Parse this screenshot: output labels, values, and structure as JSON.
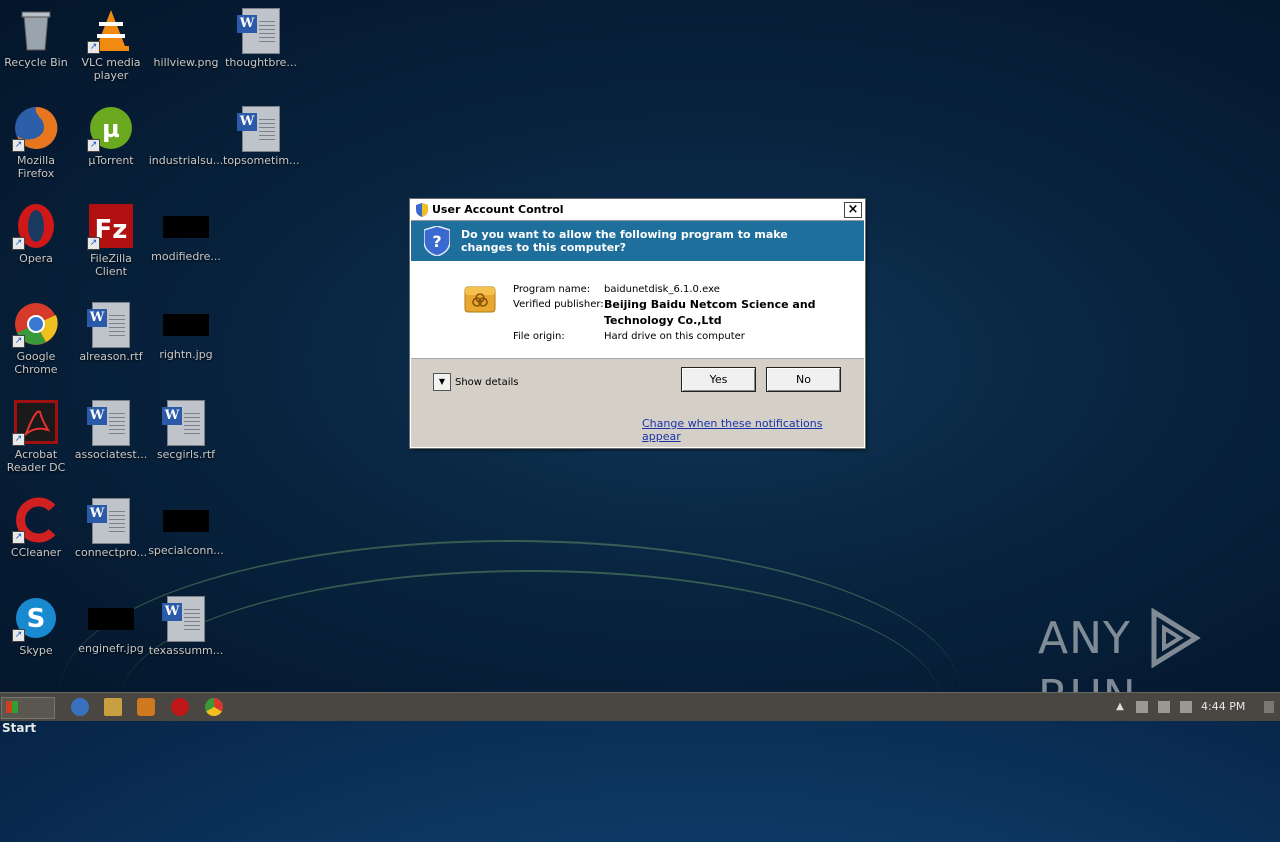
{
  "desktop": {
    "icons": [
      {
        "label": "Recycle Bin",
        "icon": "recycle-bin-icon"
      },
      {
        "label": "VLC media player",
        "icon": "vlc-icon"
      },
      {
        "label": "hillview.png",
        "icon": "image-file-icon"
      },
      {
        "label": "thoughtbre...",
        "icon": "word-doc-icon"
      },
      {
        "label": "Mozilla Firefox",
        "icon": "firefox-icon"
      },
      {
        "label": "µTorrent",
        "icon": "utorrent-icon"
      },
      {
        "label": "industrialsu...",
        "icon": "image-file-icon"
      },
      {
        "label": "topsometim...",
        "icon": "word-doc-icon"
      },
      {
        "label": "Opera",
        "icon": "opera-icon"
      },
      {
        "label": "FileZilla Client",
        "icon": "filezilla-icon"
      },
      {
        "label": "modifiedre...",
        "icon": "image-file-icon"
      },
      {
        "label": "Google Chrome",
        "icon": "chrome-icon"
      },
      {
        "label": "alreason.rtf",
        "icon": "word-doc-icon"
      },
      {
        "label": "rightn.jpg",
        "icon": "image-file-icon"
      },
      {
        "label": "Acrobat Reader DC",
        "icon": "acrobat-icon"
      },
      {
        "label": "associatest...",
        "icon": "word-doc-icon"
      },
      {
        "label": "secgirls.rtf",
        "icon": "word-doc-icon"
      },
      {
        "label": "CCleaner",
        "icon": "ccleaner-icon"
      },
      {
        "label": "connectpro...",
        "icon": "word-doc-icon"
      },
      {
        "label": "specialconn...",
        "icon": "image-file-icon"
      },
      {
        "label": "Skype",
        "icon": "skype-icon"
      },
      {
        "label": "enginefr.jpg",
        "icon": "image-file-icon"
      },
      {
        "label": "texassumm...",
        "icon": "word-doc-icon"
      }
    ]
  },
  "uac": {
    "title": "User Account Control",
    "question": "Do you want to allow the following program to make changes to this computer?",
    "fields": {
      "program_name_label": "Program name:",
      "program_name": "baidunetdisk_6.1.0.exe",
      "publisher_label": "Verified publisher:",
      "publisher_line1": "Beijing Baidu Netcom Science and",
      "publisher_line2": "Technology Co.,Ltd",
      "origin_label": "File origin:",
      "origin": "Hard drive on this computer"
    },
    "show_details": "Show details",
    "yes": "Yes",
    "no": "No",
    "link": "Change when these notifications appear",
    "colors": {
      "banner": "#1f6f9c"
    }
  },
  "watermark": {
    "left": "ANY",
    "right": "RUN"
  },
  "taskbar": {
    "start": "Start",
    "clock": "4:44 PM"
  }
}
